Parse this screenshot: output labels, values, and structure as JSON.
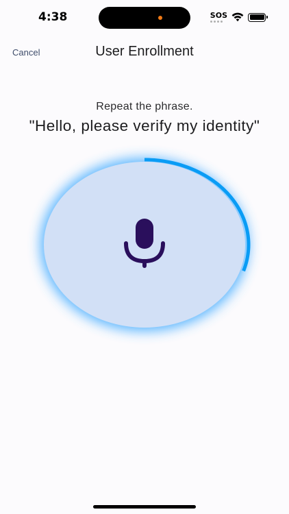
{
  "status_bar": {
    "time": "4:38",
    "sos": "SOS"
  },
  "nav": {
    "cancel_label": "Cancel",
    "title": "User Enrollment"
  },
  "prompt": {
    "instruction": "Repeat the phrase.",
    "phrase": "\"Hello, please verify my identity\""
  },
  "recorder": {
    "icon": "microphone-icon",
    "progress": 0.3,
    "colors": {
      "fill": "#d2e0f6",
      "glow": "#3aa8ff",
      "progress_arc": "#0a9cf5",
      "mic": "#2a0f5c"
    }
  },
  "colors": {
    "background": "#fcfbfd",
    "cancel": "#3f4d6b",
    "island_indicator": "#f07a16"
  }
}
